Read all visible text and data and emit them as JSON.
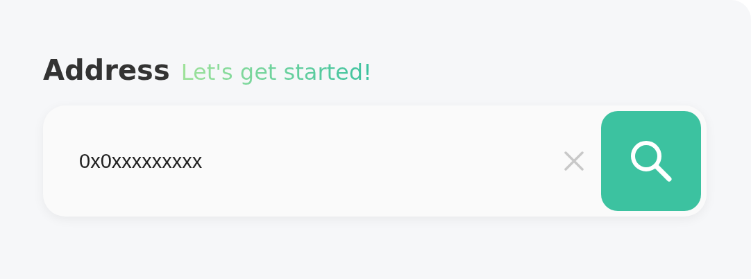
{
  "heading": {
    "title": "Address",
    "subtitle": "Let's get started!"
  },
  "search": {
    "value": "0x0xxxxxxxxx"
  }
}
